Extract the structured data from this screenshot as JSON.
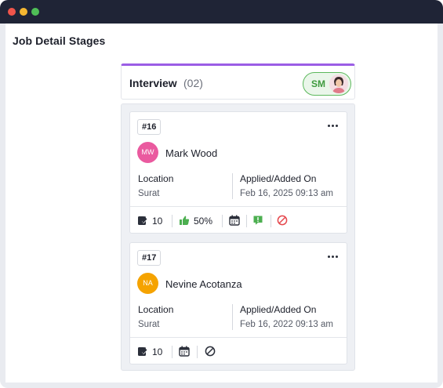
{
  "window": {
    "controls": [
      "close",
      "minimize",
      "maximize"
    ]
  },
  "page": {
    "title": "Job Detail Stages"
  },
  "stage": {
    "name": "Interview",
    "count": "(02)",
    "owner_initials": "SM",
    "accent_color": "#9b5de5"
  },
  "cards": [
    {
      "id": "#16",
      "initials": "MW",
      "avatar_color": "#ea5a9f",
      "name": "Mark Wood",
      "location_label": "Location",
      "location": "Surat",
      "applied_label": "Applied/Added On",
      "applied": "Feb 16, 2025 09:13 am",
      "notes_count": "10",
      "rating": "50%"
    },
    {
      "id": "#17",
      "initials": "NA",
      "avatar_color": "#f5a300",
      "name": "Nevine Acotanza",
      "location_label": "Location",
      "location": "Surat",
      "applied_label": "Applied/Added On",
      "applied": "Feb 16, 2022 09:13 am",
      "notes_count": "10"
    }
  ]
}
